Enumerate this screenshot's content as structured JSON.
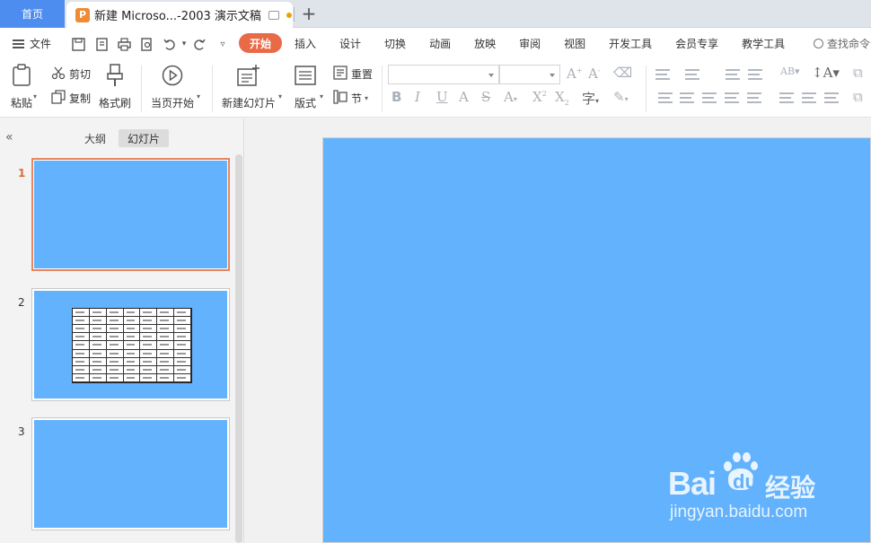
{
  "tabbar": {
    "home_label": "首页",
    "doc_logo": "P",
    "doc_title": "新建 Microso...-2003 演示文稿",
    "new_tab_symbol": "+"
  },
  "menu": {
    "file_label": "文件",
    "tabs": [
      "开始",
      "插入",
      "设计",
      "切换",
      "动画",
      "放映",
      "审阅",
      "视图",
      "开发工具",
      "会员专享",
      "教学工具"
    ],
    "active_tab": "开始",
    "search_label": "查找命令"
  },
  "ribbon": {
    "paste_label": "粘贴",
    "cut_label": "剪切",
    "copy_label": "复制",
    "format_painter_label": "格式刷",
    "play_from_current_label": "当页开始",
    "new_slide_label": "新建幻灯片",
    "layout_label": "版式",
    "reset_label": "重置",
    "section_label": "节",
    "font_name_value": "",
    "font_size_value": ""
  },
  "left_pane": {
    "outline_label": "大纲",
    "slides_label": "幻灯片",
    "collapse_symbol": "«",
    "slides": [
      {
        "number": "1",
        "active": true,
        "has_table": false
      },
      {
        "number": "2",
        "active": false,
        "has_table": true
      },
      {
        "number": "3",
        "active": false,
        "has_table": false
      }
    ]
  },
  "slide": {
    "background_color": "#63b2fd"
  },
  "watermark": {
    "brand_left": "Bai",
    "brand_mid": "du",
    "brand_cn": "经验",
    "url": "jingyan.baidu.com"
  },
  "colors": {
    "accent_tab": "#e86a47",
    "home_tab": "#4d8df0",
    "slide_blue": "#63b2fd",
    "active_thumb_border": "#e8855c"
  }
}
